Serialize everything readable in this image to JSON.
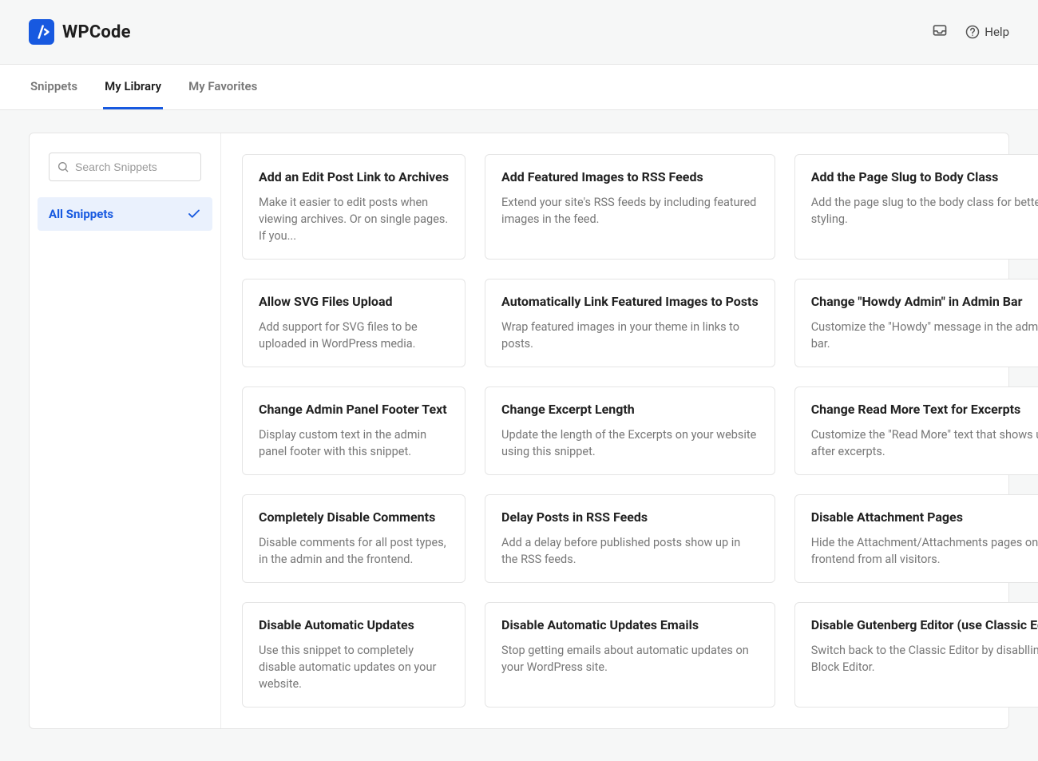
{
  "header": {
    "brand": "WPCode",
    "help_label": "Help"
  },
  "tabs": [
    {
      "label": "Snippets",
      "active": false
    },
    {
      "label": "My Library",
      "active": true
    },
    {
      "label": "My Favorites",
      "active": false
    }
  ],
  "sidebar": {
    "search_placeholder": "Search Snippets",
    "categories": [
      {
        "label": "All Snippets",
        "selected": true
      }
    ]
  },
  "cards": [
    {
      "title": "Add an Edit Post Link to Archives",
      "desc": "Make it easier to edit posts when viewing archives. Or on single pages. If you..."
    },
    {
      "title": "Add Featured Images to RSS Feeds",
      "desc": "Extend your site's RSS feeds by including featured images in the feed."
    },
    {
      "title": "Add the Page Slug to Body Class",
      "desc": "Add the page slug to the body class for better styling."
    },
    {
      "title": "Allow SVG Files Upload",
      "desc": "Add support for SVG files to be uploaded in WordPress media."
    },
    {
      "title": "Automatically Link Featured Images to Posts",
      "desc": "Wrap featured images in your theme in links to posts."
    },
    {
      "title": "Change \"Howdy Admin\" in Admin Bar",
      "desc": "Customize the \"Howdy\" message in the admin bar."
    },
    {
      "title": "Change Admin Panel Footer Text",
      "desc": "Display custom text in the admin panel footer with this snippet."
    },
    {
      "title": "Change Excerpt Length",
      "desc": "Update the length of the Excerpts on your website using this snippet."
    },
    {
      "title": "Change Read More Text for Excerpts",
      "desc": "Customize the \"Read More\" text that shows up after excerpts."
    },
    {
      "title": "Completely Disable Comments",
      "desc": "Disable comments for all post types, in the admin and the frontend."
    },
    {
      "title": "Delay Posts in RSS Feeds",
      "desc": "Add a delay before published posts show up in the RSS feeds."
    },
    {
      "title": "Disable Attachment Pages",
      "desc": "Hide the Attachment/Attachments pages on the frontend from all visitors."
    },
    {
      "title": "Disable Automatic Updates",
      "desc": "Use this snippet to completely disable automatic updates on your website."
    },
    {
      "title": "Disable Automatic Updates Emails",
      "desc": "Stop getting emails about automatic updates on your WordPress site."
    },
    {
      "title": "Disable Gutenberg Editor (use Classic Editor)",
      "desc": "Switch back to the Classic Editor by disablling the Block Editor."
    }
  ]
}
